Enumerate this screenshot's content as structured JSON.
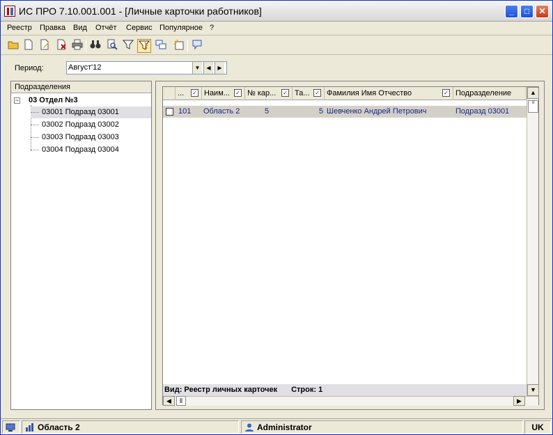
{
  "window": {
    "title": "ИС ПРО 7.10.001.001 - [Личные карточки работников]",
    "min_label": "_",
    "max_label": "□",
    "close_label": "✕"
  },
  "menu": [
    "Реестр",
    "Правка",
    "Вид",
    "Отчёт",
    "Сервис",
    "Популярное",
    "?"
  ],
  "toolbar": {
    "icons": [
      "open-folder-icon",
      "new-document-icon",
      "edit-document-icon",
      "delete-document-icon",
      "print-icon",
      "binoculars-icon",
      "search-preview-icon",
      "filter-icon",
      "quick-filter-icon",
      "grid-view-icon",
      "new-item-icon",
      "message-icon"
    ]
  },
  "period": {
    "label": "Период:",
    "value": "Август'12"
  },
  "tree": {
    "header": "Подразделения",
    "root": "03 Отдел №3",
    "root_toggle": "−",
    "items": [
      {
        "label": "03001 Подразд 03001",
        "selected": true
      },
      {
        "label": "03002 Подразд 03002",
        "selected": false
      },
      {
        "label": "03003 Подразд 03003",
        "selected": false
      },
      {
        "label": "03004 Подразд 03004",
        "selected": false
      }
    ]
  },
  "grid": {
    "columns": [
      "...",
      "Наим...",
      "№ кар...",
      "Та...",
      "Фамилия Имя Отчество",
      "Подразделение"
    ],
    "rows": [
      {
        "code": "101",
        "name": "Область 2",
        "card_no": "5",
        "tab_no": "5",
        "fio": "Шевченко Андрей Петрович",
        "division": "Подразд 03001"
      }
    ],
    "footer_view": "Вид: Реестр личных карточек",
    "footer_rows": "Строк: 1"
  },
  "status": {
    "org": "Область 2",
    "user": "Administrator",
    "lang": "UK"
  }
}
